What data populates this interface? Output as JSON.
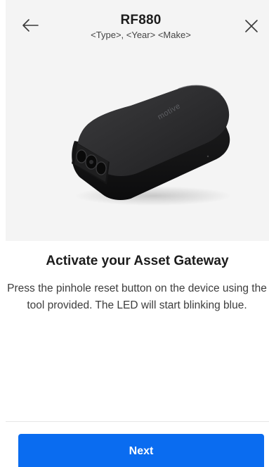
{
  "header": {
    "title": "RF880",
    "subtitle": "<Type>, <Year> <Make>",
    "back_icon": "arrow-left-icon",
    "close_icon": "close-icon"
  },
  "hero": {
    "image": "asset-gateway-device-image",
    "device_brand": "motive"
  },
  "content": {
    "heading": "Activate your Asset Gateway",
    "body": "Press the pinhole reset button on the device using the tool provided. The LED will start blinking blue."
  },
  "footer": {
    "next_label": "Next"
  },
  "colors": {
    "primary": "#0a6cf0",
    "hero_bg": "#f4f4f4",
    "text_dark": "#1c1c1c"
  }
}
